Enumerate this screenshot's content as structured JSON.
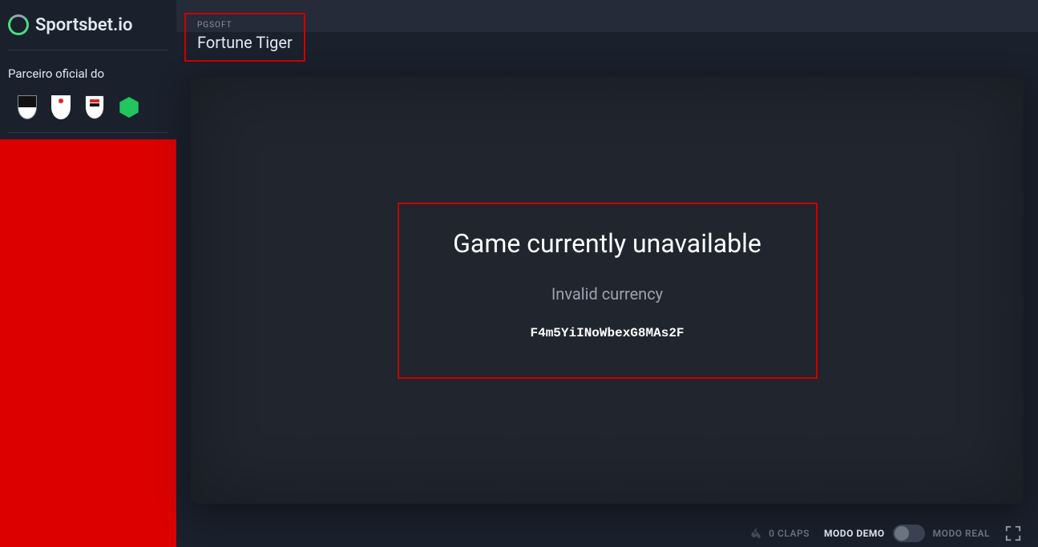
{
  "brand": "Sportsbet.io",
  "sidebar": {
    "partner_title": "Parceiro oficial do"
  },
  "header": {
    "provider": "PGSOFT",
    "game_name": "Fortune Tiger"
  },
  "error": {
    "title": "Game currently unavailable",
    "message": "Invalid currency",
    "code": "F4m5YiINoWbexG8MAs2F"
  },
  "footer": {
    "claps_label": "0 CLAPS",
    "mode_demo": "MODO DEMO",
    "mode_real": "MODO REAL"
  }
}
